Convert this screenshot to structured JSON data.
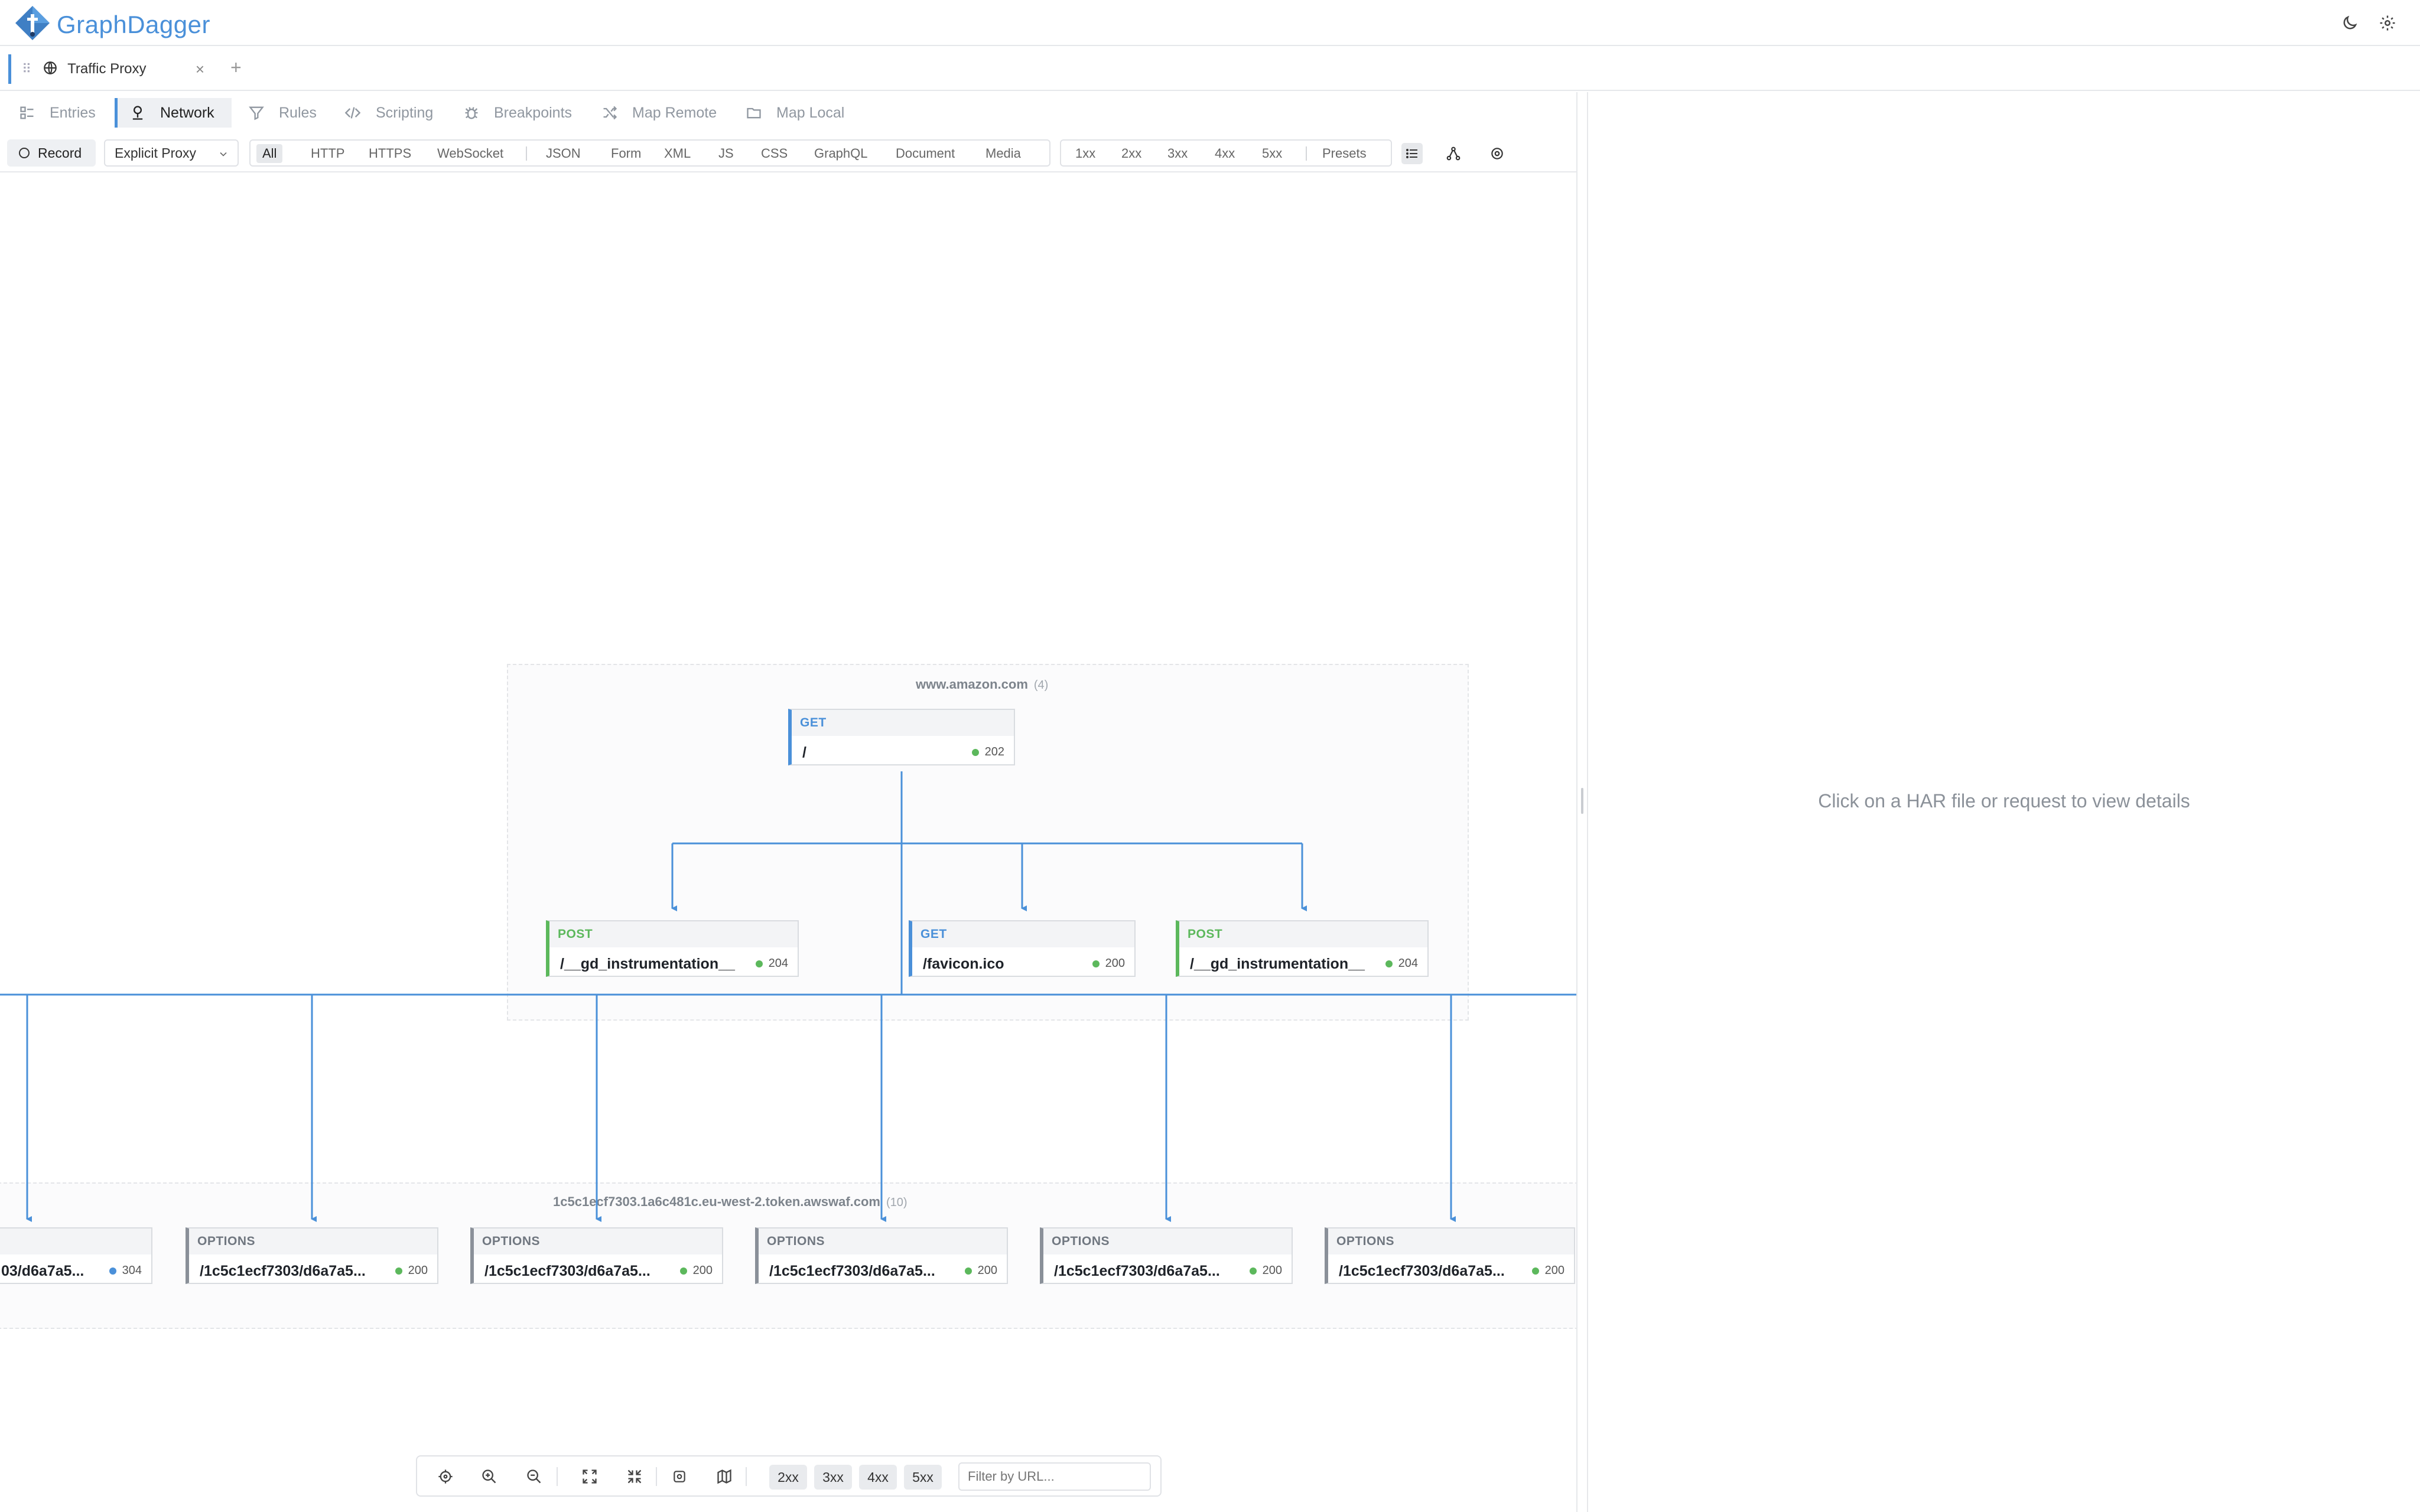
{
  "app": {
    "name": "GraphDagger"
  },
  "header": {
    "theme_icon": "moon-icon",
    "settings_icon": "gear-icon"
  },
  "tabs": [
    {
      "label": "Traffic Proxy",
      "icon": "globe-icon",
      "active": true
    }
  ],
  "nav": {
    "items": [
      {
        "label": "Entries",
        "icon": "list-icon"
      },
      {
        "label": "Network",
        "icon": "network-icon",
        "active": true
      },
      {
        "label": "Rules",
        "icon": "filter-icon"
      },
      {
        "label": "Scripting",
        "icon": "code-icon"
      },
      {
        "label": "Breakpoints",
        "icon": "bug-icon"
      },
      {
        "label": "Map Remote",
        "icon": "shuffle-icon"
      },
      {
        "label": "Map Local",
        "icon": "folder-icon"
      }
    ]
  },
  "toolbar": {
    "record_label": "Record",
    "proxy_mode": "Explicit Proxy",
    "type_filters": [
      "All",
      "HTTP",
      "HTTPS",
      "WebSocket",
      "JSON",
      "Form",
      "XML",
      "JS",
      "CSS",
      "GraphQL",
      "Document",
      "Media"
    ],
    "active_type": "All",
    "status_filters": [
      "1xx",
      "2xx",
      "3xx",
      "4xx",
      "5xx"
    ],
    "presets_label": "Presets"
  },
  "graph": {
    "groups": [
      {
        "host": "www.amazon.com",
        "count": "(4)"
      },
      {
        "host": "1c5c1ecf7303.1a6c481c.eu-west-2.token.awswaf.com",
        "count": "(10)"
      }
    ],
    "nodes": [
      {
        "method": "GET",
        "path": "/",
        "status": "202",
        "status_color": "#5cb85c"
      },
      {
        "method": "POST",
        "path": "/__gd_instrumentation__",
        "status": "204",
        "status_color": "#5cb85c"
      },
      {
        "method": "GET",
        "path": "/favicon.ico",
        "status": "200",
        "status_color": "#5cb85c"
      },
      {
        "method": "POST",
        "path": "/__gd_instrumentation__",
        "status": "204",
        "status_color": "#5cb85c"
      },
      {
        "method": "",
        "path": "03/d6a7a5...",
        "status": "304",
        "status_color": "#4a90d9"
      },
      {
        "method": "OPTIONS",
        "path": "/1c5c1ecf7303/d6a7a5...",
        "status": "200",
        "status_color": "#5cb85c"
      },
      {
        "method": "OPTIONS",
        "path": "/1c5c1ecf7303/d6a7a5...",
        "status": "200",
        "status_color": "#5cb85c"
      },
      {
        "method": "OPTIONS",
        "path": "/1c5c1ecf7303/d6a7a5...",
        "status": "200",
        "status_color": "#5cb85c"
      },
      {
        "method": "OPTIONS",
        "path": "/1c5c1ecf7303/d6a7a5...",
        "status": "200",
        "status_color": "#5cb85c"
      },
      {
        "method": "OPTIONS",
        "path": "/1c5c1ecf7303/d6a7a5...",
        "status": "200",
        "status_color": "#5cb85c"
      }
    ]
  },
  "graph_toolbar": {
    "status_chips": [
      "2xx",
      "3xx",
      "4xx",
      "5xx"
    ],
    "filter_placeholder": "Filter by URL..."
  },
  "details": {
    "placeholder": "Click on a HAR file or request to view details"
  },
  "colors": {
    "accent": "#4a90d9",
    "post": "#5cb85c",
    "options": "#8a9099",
    "edge": "#4a90d9"
  }
}
